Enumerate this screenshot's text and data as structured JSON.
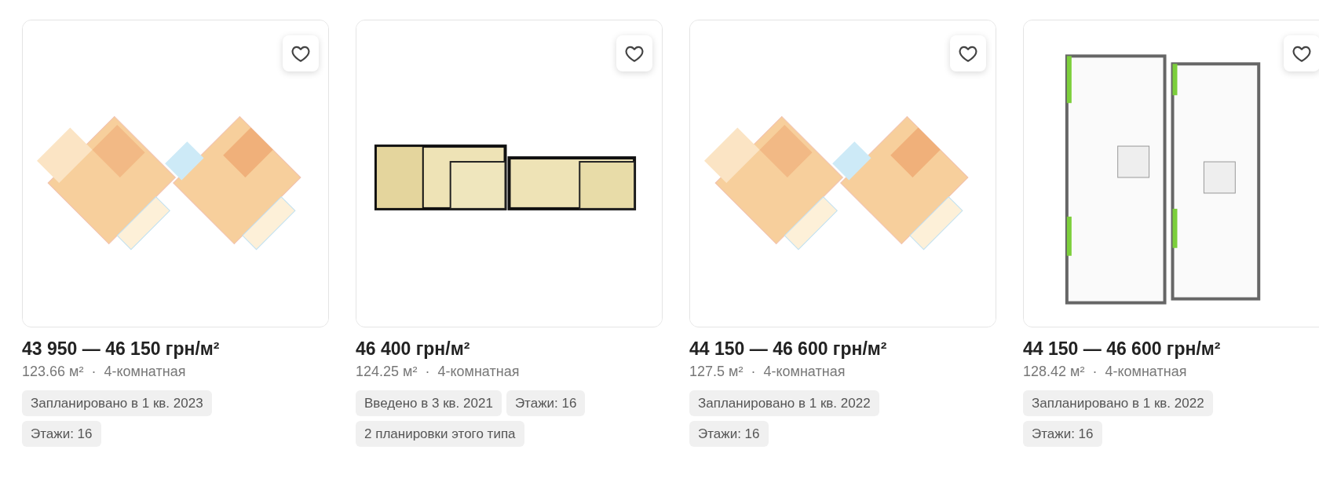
{
  "listings": [
    {
      "image": {
        "kind": "picture"
      },
      "favorite": false,
      "price": "43 950 — 46 150 грн/м²",
      "area": "123.66 м²",
      "separator": "·",
      "rooms": "4-комнатная",
      "tags": [
        "Запланировано в 1 кв. 2023",
        "Этажи: 16"
      ]
    },
    {
      "image": {
        "kind": "picture"
      },
      "favorite": false,
      "price": "46 400 грн/м²",
      "area": "124.25 м²",
      "separator": "·",
      "rooms": "4-комнатная",
      "tags": [
        "Введено в 3 кв. 2021",
        "Этажи: 16",
        "2 планировки этого типа"
      ]
    },
    {
      "image": {
        "kind": "picture"
      },
      "favorite": false,
      "price": "44 150 — 46 600 грн/м²",
      "area": "127.5 м²",
      "separator": "·",
      "rooms": "4-комнатная",
      "tags": [
        "Запланировано в 1 кв. 2022",
        "Этажи: 16"
      ]
    },
    {
      "image": {
        "kind": "picture"
      },
      "favorite": false,
      "price": "44 150 — 46 600 грн/м²",
      "area": "128.42 м²",
      "separator": "·",
      "rooms": "4-комнатная",
      "tags": [
        "Запланировано в 1 кв. 2022",
        "Этажи: 16"
      ]
    }
  ]
}
